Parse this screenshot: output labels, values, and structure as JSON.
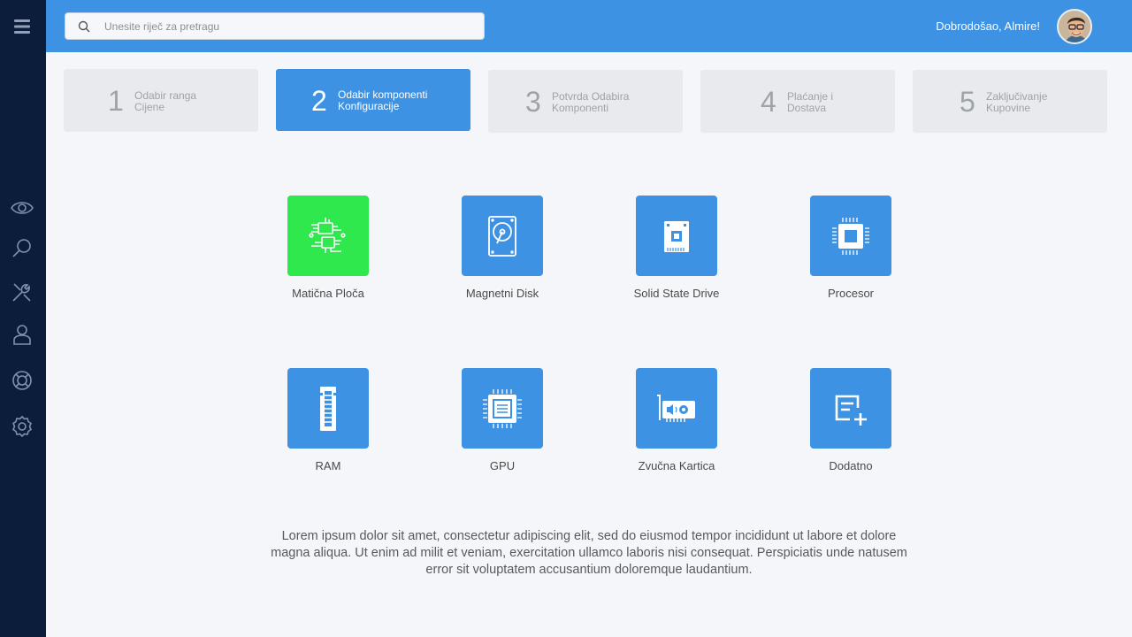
{
  "header": {
    "search_placeholder": "Unesite riječ za pretragu",
    "welcome": "Dobrodošao, Almire!"
  },
  "sidebar": {
    "icons": [
      "menu-icon",
      "eye-icon",
      "search-icon",
      "tools-icon",
      "user-icon",
      "lifebuoy-icon",
      "gear-icon"
    ]
  },
  "steps": [
    {
      "num": "1",
      "line1": "Odabir ranga",
      "line2": "Cijene"
    },
    {
      "num": "2",
      "line1": "Odabir komponenti",
      "line2": "Konfiguracije"
    },
    {
      "num": "3",
      "line1": "Potvrda Odabira",
      "line2": "Komponenti"
    },
    {
      "num": "4",
      "line1": "Plaćanje i",
      "line2": "Dostava"
    },
    {
      "num": "5",
      "line1": "Zaključivanje",
      "line2": "Kupovine"
    }
  ],
  "components": [
    {
      "label": "Matična Ploča",
      "icon": "motherboard-icon"
    },
    {
      "label": "Magnetni Disk",
      "icon": "hard-disk-icon"
    },
    {
      "label": "Solid State Drive",
      "icon": "ssd-icon"
    },
    {
      "label": "Procesor",
      "icon": "cpu-icon"
    },
    {
      "label": "RAM",
      "icon": "ram-icon"
    },
    {
      "label": "GPU",
      "icon": "gpu-icon"
    },
    {
      "label": "Zvučna Kartica",
      "icon": "sound-card-icon"
    },
    {
      "label": "Dodatno",
      "icon": "add-list-icon"
    }
  ],
  "description": "Lorem ipsum dolor sit amet, consectetur adipiscing elit, sed do eiusmod tempor incididunt ut labore et dolore magna aliqua. Ut enim ad  milit et veniam, exercitation ullamco laboris nisi consequat. Perspiciatis unde natusem error sit voluptatem accusantium doloremque laudantium.",
  "colors": {
    "sidebar": "#0b1d3b",
    "topbar": "#3d92e4",
    "tile": "#3d92e4",
    "tile_selected": "#2fe84d",
    "step_inactive": "#e8eaed"
  }
}
